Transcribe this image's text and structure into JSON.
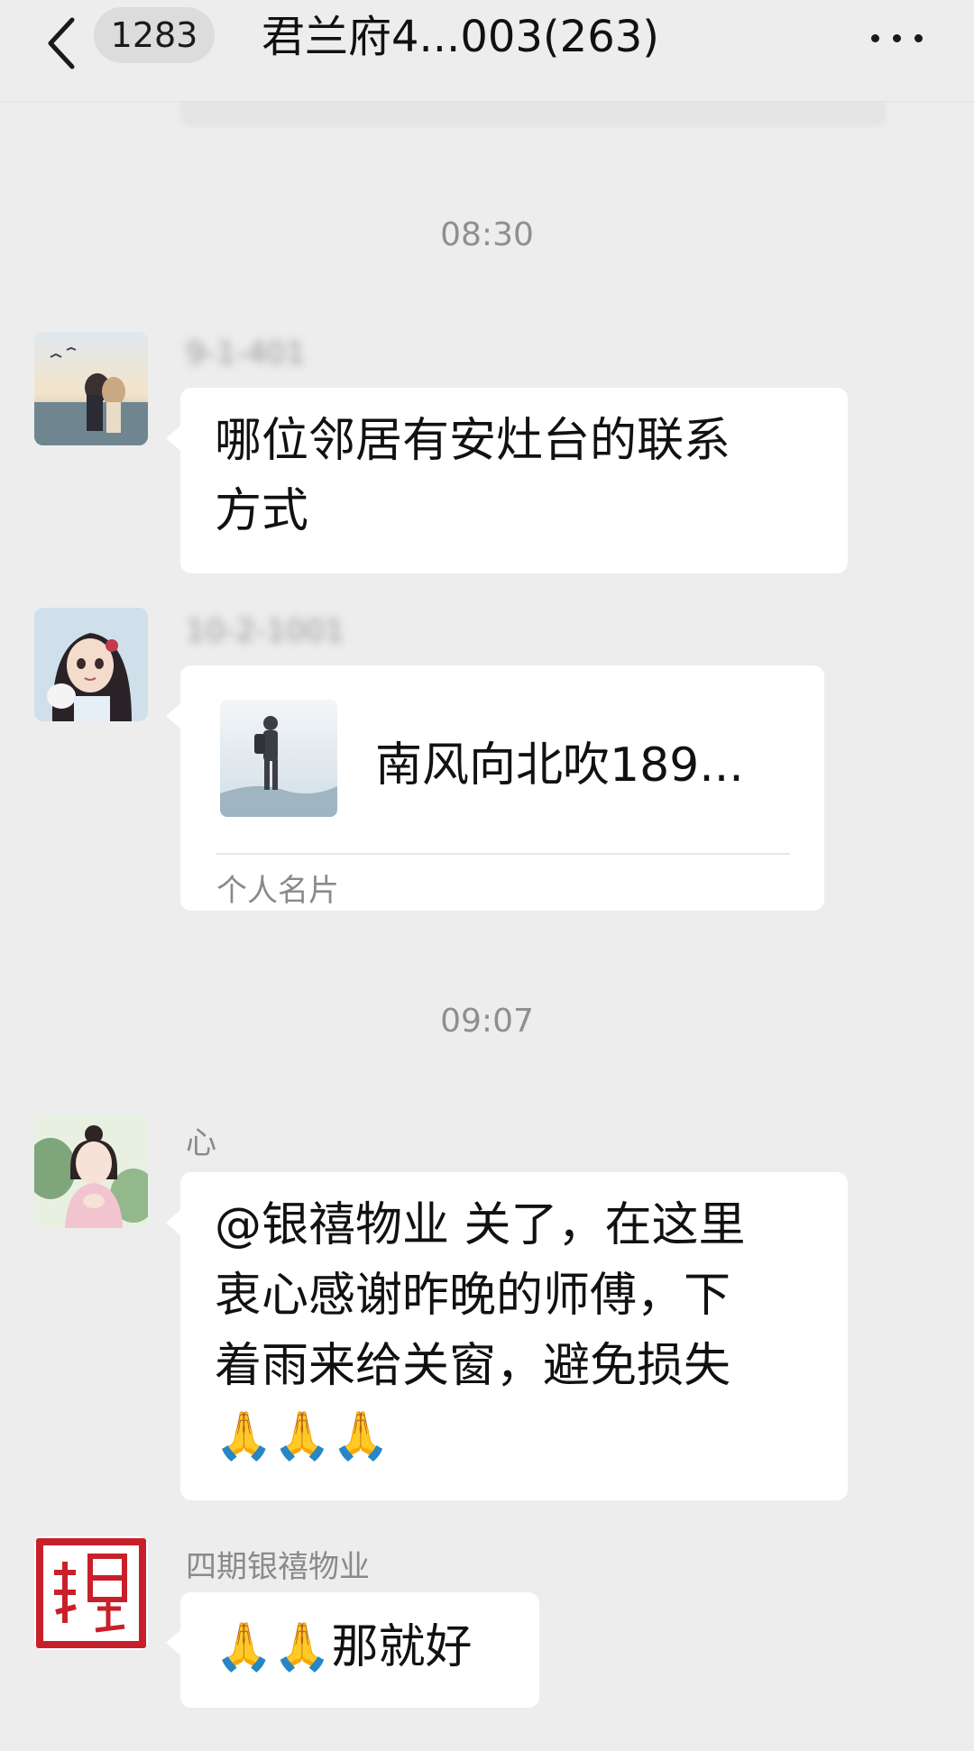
{
  "header": {
    "back_icon": "chevron-left-icon",
    "unread_count": "1283",
    "title": "君兰府4...003(263)",
    "more_icon": "more-dots-icon"
  },
  "messages": {
    "time1": "08:30",
    "msg1": {
      "sender": "9-1-401",
      "text_line1": "哪位邻居有安灶台的联系",
      "text_line2": "方式"
    },
    "msg2": {
      "sender": "10-2-1001",
      "card_name": "南风向北吹189...",
      "card_type": "个人名片"
    },
    "time2": "09:07",
    "msg3": {
      "sender": "心",
      "line1": "@银禧物业  关了，在这里",
      "line2": "衷心感谢昨晚的师傅，下",
      "line3": "着雨来给关窗，避免损失",
      "line4": "🙏🙏🙏"
    },
    "msg4": {
      "sender": "四期银禧物业",
      "emoji": "🙏🙏",
      "text": "那就好"
    }
  },
  "colors": {
    "background": "#ededed",
    "bubble": "#ffffff",
    "timestamp": "#8f8f8f",
    "sender": "#8a8a8a",
    "seal_red": "#c8202a"
  }
}
